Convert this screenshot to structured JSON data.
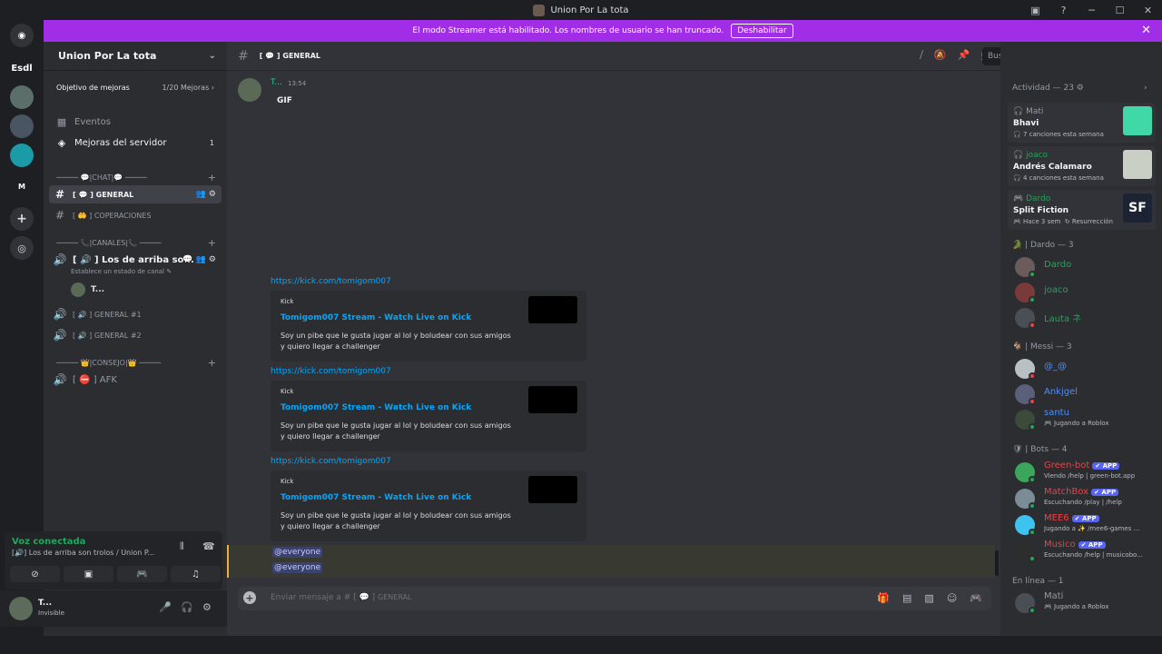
{
  "window": {
    "title": "Union Por La tota"
  },
  "banner": {
    "text": "El modo Streamer está habilitado. Los nombres de usuario se han truncado.",
    "button": "Deshabilitar"
  },
  "servers": {
    "esdl": "Esdl",
    "m_label": "M"
  },
  "sidebar": {
    "server_name": "Union Por La tota",
    "boost_goal": "Objetivo de mejoras",
    "boost_count": "1/20 Mejoras",
    "events": "Eventos",
    "server_boosts": "Mejoras del servidor",
    "server_boosts_badge": "1",
    "cat_chat": "───── 💬|CHAT|💬 ─────",
    "ch_general": "GENERAL",
    "ch_cooperaciones": "COPERACIONES",
    "cat_canales": "───── 📞|CANALES|📞 ─────",
    "voice_1": "Los de arriba so...",
    "voice_1_status": "Establece un estado de canal",
    "voice_1_user": "T...",
    "voice_2": "GENERAL #1",
    "voice_3": "GENERAL #2",
    "cat_consejo": "───── 👑|CONSEJO|👑 ─────",
    "voice_afk": "AFK"
  },
  "voice_panel": {
    "title": "Voz conectada",
    "channel": "Los de arriba son trolos / Union P..."
  },
  "user_panel": {
    "name": "T...",
    "status": "Invisible"
  },
  "channel": {
    "name": "GENERAL",
    "search_placeholder": "Buscar"
  },
  "messages": {
    "author": "T...",
    "time": "13:54",
    "gif": "GIF",
    "links": [
      {
        "url": "https://kick.com/tomigom007",
        "provider": "Kick",
        "title": "Tomigom007 Stream - Watch Live on Kick",
        "desc": "Soy un pibe que le gusta jugar al lol y boludear con sus amigos y quiero llegar a challenger"
      },
      {
        "url": "https://kick.com/tomigom007",
        "provider": "Kick",
        "title": "Tomigom007 Stream - Watch Live on Kick",
        "desc": "Soy un pibe que le gusta jugar al lol y boludear con sus amigos y quiero llegar a challenger"
      },
      {
        "url": "https://kick.com/tomigom007",
        "provider": "Kick",
        "title": "Tomigom007 Stream - Watch Live on Kick",
        "desc": "Soy un pibe que le gusta jugar al lol y boludear con sus amigos y quiero llegar a challenger"
      }
    ],
    "mention1": "@everyone",
    "mention2": "@everyone"
  },
  "composer": {
    "placeholder": "Enviar mensaje a #",
    "channel": "GENERAL"
  },
  "activity": {
    "header": "Actividad — 23",
    "cards": [
      {
        "user": "Mati",
        "title": "Bhavi",
        "sub": "7 canciones esta semana"
      },
      {
        "user": "joaco",
        "title": "Andrés Calamaro",
        "sub": "4 canciones esta semana"
      },
      {
        "user": "Dardo",
        "title": "Split Fiction",
        "sub": "Hace 3 sem",
        "sub2": "Resurrección"
      }
    ]
  },
  "groups": {
    "dardo": "Dardo — 3",
    "messi": "Messi — 3",
    "bots": "Bots — 4",
    "online": "En línea — 1"
  },
  "members": {
    "dardo": [
      "Dardo",
      "joaco",
      "Lauta ネ"
    ],
    "messi": [
      {
        "name": "@_@"
      },
      {
        "name": "Ankjgel"
      },
      {
        "name": "santu",
        "status": "Jugando a Roblox"
      }
    ],
    "bots": [
      {
        "name": "Green-bot",
        "status": "Viendo /help | green-bot.app"
      },
      {
        "name": "MatchBox",
        "status": "Escuchando /play | /help"
      },
      {
        "name": "MEE6",
        "status": "Jugando a ✨ /mee6-games ..."
      },
      {
        "name": "Musico",
        "status": "Escuchando /help | musicobo..."
      }
    ],
    "online": [
      {
        "name": "Mati",
        "status": "Jugando a Roblox"
      }
    ],
    "app_badge": "APP"
  },
  "colors": {
    "accent": "#5865f2",
    "banner": "#a12de6",
    "online": "#23a55a",
    "dnd": "#f23f43",
    "link": "#00a8fc"
  }
}
